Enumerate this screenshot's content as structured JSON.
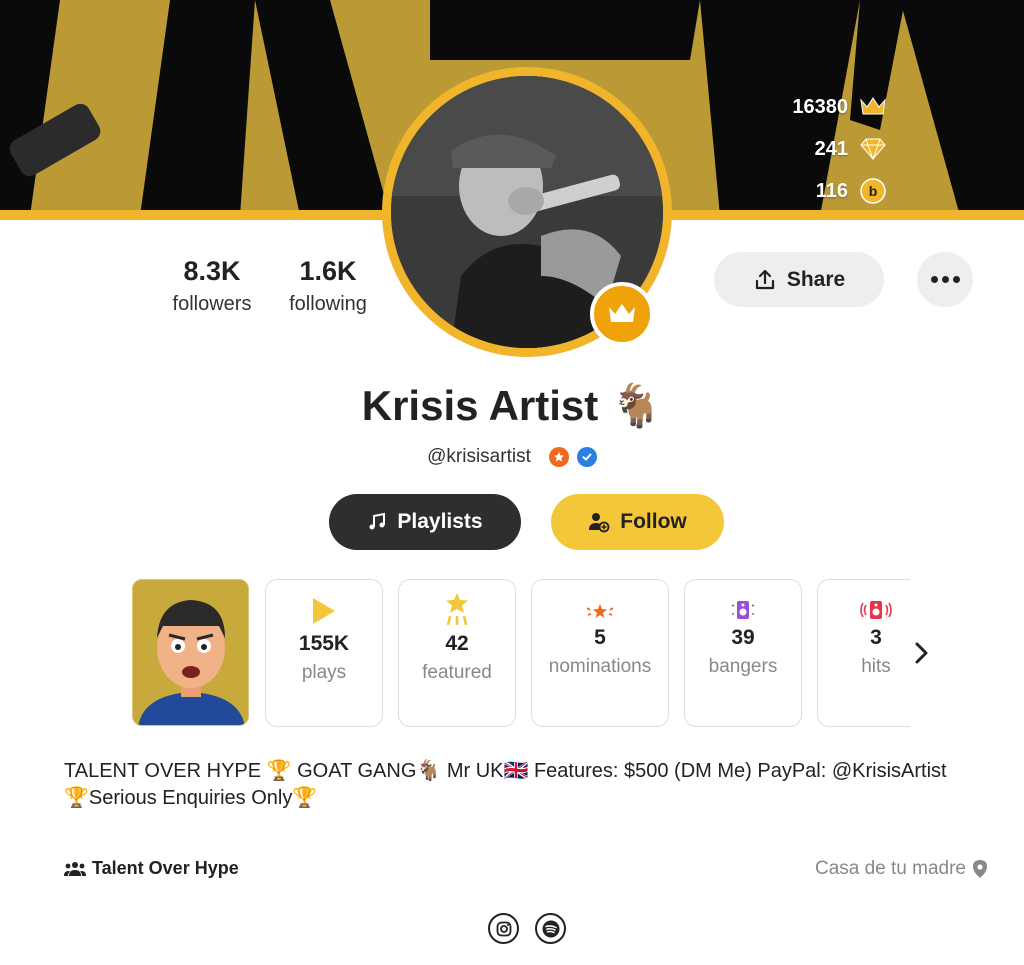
{
  "currencies": [
    {
      "value": "16380",
      "icon": "crown-icon"
    },
    {
      "value": "241",
      "icon": "diamond-icon"
    },
    {
      "value": "116",
      "icon": "coin-icon"
    }
  ],
  "profile": {
    "followers_count": "8.3K",
    "followers_label": "followers",
    "following_count": "1.6K",
    "following_label": "following",
    "name": "Krisis Artist",
    "name_emoji": "🐐",
    "handle": "@krisisartist"
  },
  "actions": {
    "share_label": "Share",
    "playlists_label": "Playlists",
    "follow_label": "Follow"
  },
  "stats": [
    {
      "value": "155K",
      "label": "plays",
      "icon": "play-icon"
    },
    {
      "value": "42",
      "label": "featured",
      "icon": "star-icon"
    },
    {
      "value": "5",
      "label": "nominations",
      "icon": "award-icon"
    },
    {
      "value": "39",
      "label": "bangers",
      "icon": "speaker-icon"
    },
    {
      "value": "3",
      "label": "hits",
      "icon": "speaker-loud-icon"
    }
  ],
  "bio": {
    "line1": "TALENT OVER HYPE 🏆 GOAT GANG🐐 Mr UK🇬🇧 Features: $500 (DM Me) PayPal: @KrisisArtist",
    "line2": "🏆Serious Enquiries Only🏆"
  },
  "footer": {
    "group_name": "Talent Over Hype",
    "location": "Casa de tu madre"
  },
  "colors": {
    "accent": "#f0b52a",
    "follow": "#f4c63a",
    "dark_button": "#2e2e2e"
  }
}
